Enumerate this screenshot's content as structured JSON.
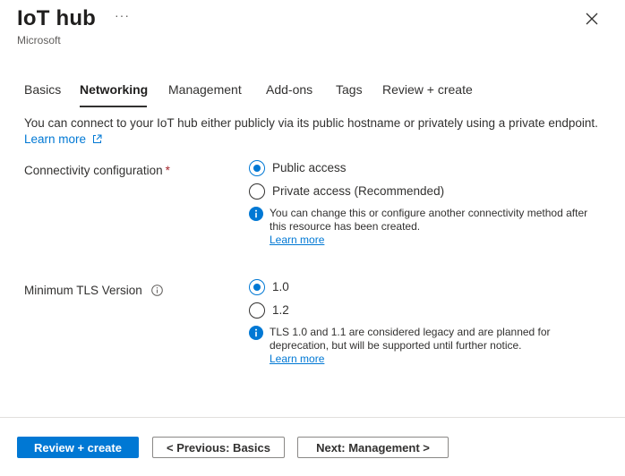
{
  "header": {
    "title": "IoT hub",
    "more_label": "···",
    "subtitle": "Microsoft"
  },
  "tabs": [
    {
      "label": "Basics",
      "active": false
    },
    {
      "label": "Networking",
      "active": true
    },
    {
      "label": "Management",
      "active": false
    },
    {
      "label": "Add-ons",
      "active": false
    },
    {
      "label": "Tags",
      "active": false
    },
    {
      "label": "Review + create",
      "active": false
    }
  ],
  "networking": {
    "description": "You can connect to your IoT hub either publicly via its public hostname or privately using a private endpoint.",
    "learn_more": "Learn more",
    "connectivity": {
      "label": "Connectivity configuration",
      "required_mark": "*",
      "options": [
        {
          "label": "Public access",
          "checked": true
        },
        {
          "label": "Private access (Recommended)",
          "checked": false
        }
      ],
      "note_line1": "You can change this or configure another connectivity method after",
      "note_line2": "this resource has been created.",
      "note_link": "Learn more"
    },
    "tls": {
      "label": "Minimum TLS Version",
      "options": [
        {
          "label": "1.0",
          "checked": true
        },
        {
          "label": "1.2",
          "checked": false
        }
      ],
      "note_line1": "TLS 1.0 and 1.1 are considered legacy and are planned for",
      "note_line2": "deprecation, but will be supported until further notice.",
      "note_link": "Learn more"
    }
  },
  "footer": {
    "review_create": "Review + create",
    "previous": "< Previous: Basics",
    "next": "Next: Management >"
  },
  "colors": {
    "accent": "#0078d4",
    "required": "#a4262c",
    "text": "#323130"
  }
}
